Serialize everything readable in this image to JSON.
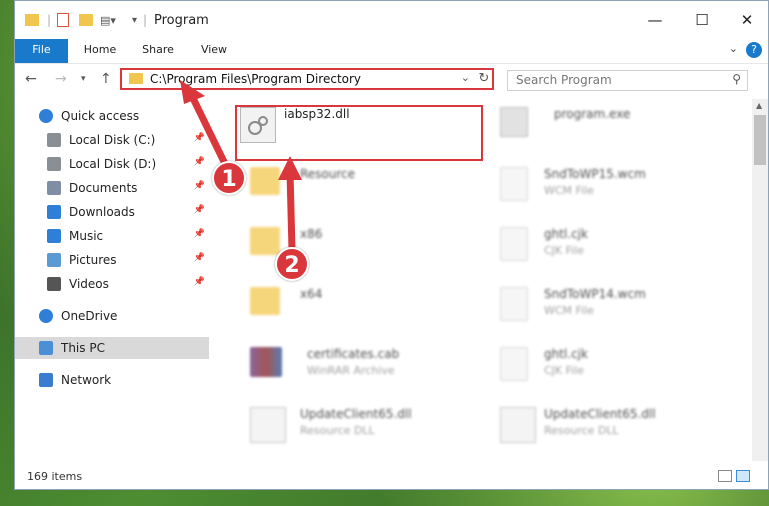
{
  "window": {
    "title": "Program"
  },
  "ribbon": {
    "tabs": [
      "File",
      "Home",
      "Share",
      "View"
    ],
    "help": "?"
  },
  "address": {
    "path": "C:\\Program Files\\Program Directory"
  },
  "search": {
    "placeholder": "Search Program"
  },
  "sidebar": {
    "items": [
      {
        "label": "Quick access",
        "icon": "star-icon",
        "pinned": false
      },
      {
        "label": "Local Disk (C:)",
        "icon": "drive-icon",
        "pinned": true
      },
      {
        "label": "Local Disk (D:)",
        "icon": "drive-icon",
        "pinned": true
      },
      {
        "label": "Documents",
        "icon": "documents-icon",
        "pinned": true
      },
      {
        "label": "Downloads",
        "icon": "download-icon",
        "pinned": true
      },
      {
        "label": "Music",
        "icon": "music-icon",
        "pinned": true
      },
      {
        "label": "Pictures",
        "icon": "pictures-icon",
        "pinned": true
      },
      {
        "label": "Videos",
        "icon": "videos-icon",
        "pinned": true
      },
      {
        "label": "OneDrive",
        "icon": "cloud-icon",
        "pinned": false
      },
      {
        "label": "This PC",
        "icon": "computer-icon",
        "pinned": false,
        "selected": true
      },
      {
        "label": "Network",
        "icon": "network-icon",
        "pinned": false
      }
    ]
  },
  "files": {
    "highlighted": {
      "name": "iabsp32.dll",
      "sub": ""
    },
    "left": [
      {
        "name": "Resource",
        "sub": ""
      },
      {
        "name": "x86",
        "sub": ""
      },
      {
        "name": "x64",
        "sub": ""
      },
      {
        "name": "certificates.cab",
        "sub": "WinRAR Archive"
      },
      {
        "name": "UpdateClient65.dll",
        "sub": "Resource DLL"
      }
    ],
    "right": [
      {
        "name": "program.exe",
        "sub": ""
      },
      {
        "name": "SndToWP15.wcm",
        "sub": "WCM File"
      },
      {
        "name": "ghtl.cjk",
        "sub": "CJK File"
      },
      {
        "name": "SndToWP14.wcm",
        "sub": "WCM File"
      },
      {
        "name": "ghtl.cjk",
        "sub": "CJK File"
      },
      {
        "name": "UpdateClient65.dll",
        "sub": "Resource DLL"
      }
    ]
  },
  "annotations": {
    "marker1": "1",
    "marker2": "2"
  },
  "status": {
    "items_count": "169 items"
  },
  "colors": {
    "accent": "#1979ca",
    "highlight": "#d9373c",
    "folder": "#f5cc5b"
  }
}
